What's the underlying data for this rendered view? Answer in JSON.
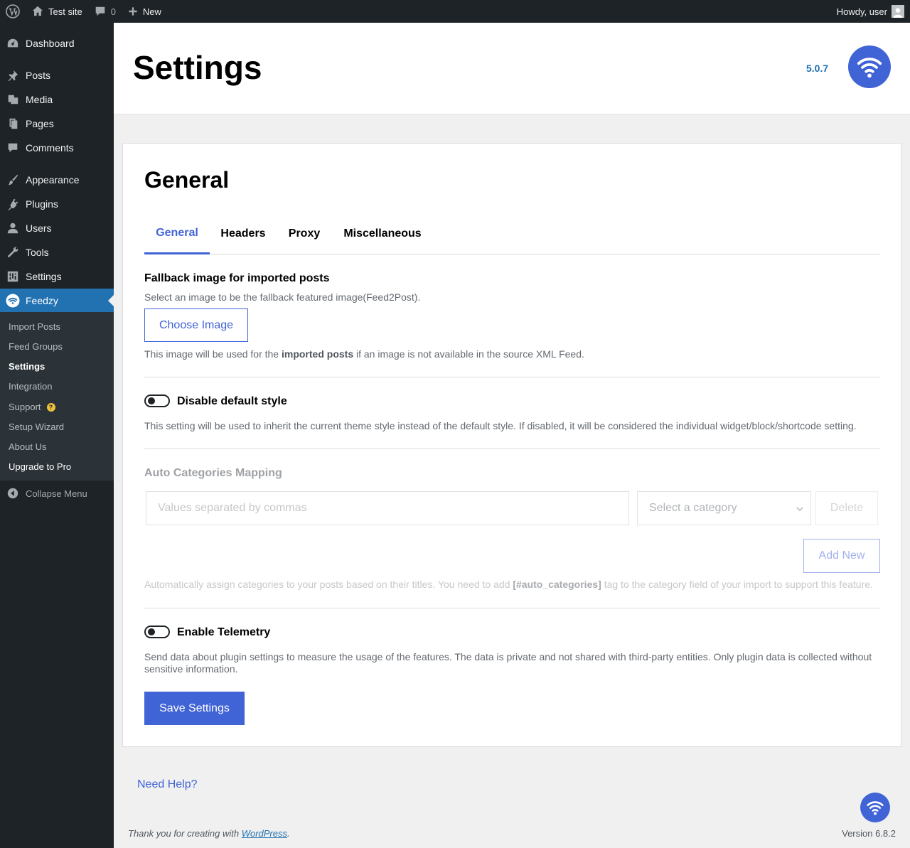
{
  "adminbar": {
    "site_name": "Test site",
    "comments_count": "0",
    "new_label": "New",
    "greeting": "Howdy, user"
  },
  "sidebar": {
    "items": [
      {
        "label": "Dashboard",
        "icon": "dashboard-icon"
      },
      {
        "label": "Posts",
        "icon": "pin-icon"
      },
      {
        "label": "Media",
        "icon": "media-icon"
      },
      {
        "label": "Pages",
        "icon": "pages-icon"
      },
      {
        "label": "Comments",
        "icon": "comment-icon"
      },
      {
        "label": "Appearance",
        "icon": "brush-icon"
      },
      {
        "label": "Plugins",
        "icon": "plug-icon"
      },
      {
        "label": "Users",
        "icon": "user-icon"
      },
      {
        "label": "Tools",
        "icon": "wrench-icon"
      },
      {
        "label": "Settings",
        "icon": "sliders-icon"
      },
      {
        "label": "Feedzy",
        "icon": "feedzy-icon"
      }
    ],
    "submenu": [
      {
        "label": "Import Posts"
      },
      {
        "label": "Feed Groups"
      },
      {
        "label": "Settings"
      },
      {
        "label": "Integration"
      },
      {
        "label": "Support",
        "badge": "?"
      },
      {
        "label": "Setup Wizard"
      },
      {
        "label": "About Us"
      },
      {
        "label": "Upgrade to Pro"
      }
    ],
    "collapse_label": "Collapse Menu"
  },
  "header": {
    "title": "Settings",
    "version": "5.0.7"
  },
  "card": {
    "title": "General",
    "tabs": [
      {
        "label": "General"
      },
      {
        "label": "Headers"
      },
      {
        "label": "Proxy"
      },
      {
        "label": "Miscellaneous"
      }
    ],
    "fallback": {
      "title": "Fallback image for imported posts",
      "desc": "Select an image to be the fallback featured image(Feed2Post).",
      "button": "Choose Image",
      "note_pre": "This image will be used for the ",
      "note_bold": "imported posts",
      "note_post": " if an image is not available in the source XML Feed."
    },
    "default_style": {
      "label": "Disable default style",
      "desc": "This setting will be used to inherit the current theme style instead of the default style. If disabled, it will be considered the individual widget/block/shortcode setting."
    },
    "auto_categories": {
      "title": "Auto Categories Mapping",
      "input_placeholder": "Values separated by commas",
      "select_value": "Select a category",
      "delete_label": "Delete",
      "add_new_label": "Add New",
      "desc_pre": "Automatically assign categories to your posts based on their titles. You need to add ",
      "desc_bold": "[#auto_categories]",
      "desc_post": " tag to the category field of your import to support this feature."
    },
    "telemetry": {
      "label": "Enable Telemetry",
      "desc": "Send data about plugin settings to measure the usage of the features. The data is private and not shared with third-party entities. Only plugin data is collected without sensitive information."
    },
    "save_label": "Save Settings"
  },
  "need_help": "Need Help?",
  "footer": {
    "thanks_pre": "Thank you for creating with ",
    "thanks_link": "WordPress",
    "thanks_post": ".",
    "version": "Version 6.8.2"
  },
  "colors": {
    "accent": "#4063d6",
    "admin_dark": "#1d2327",
    "wp_blue": "#2271b1"
  }
}
